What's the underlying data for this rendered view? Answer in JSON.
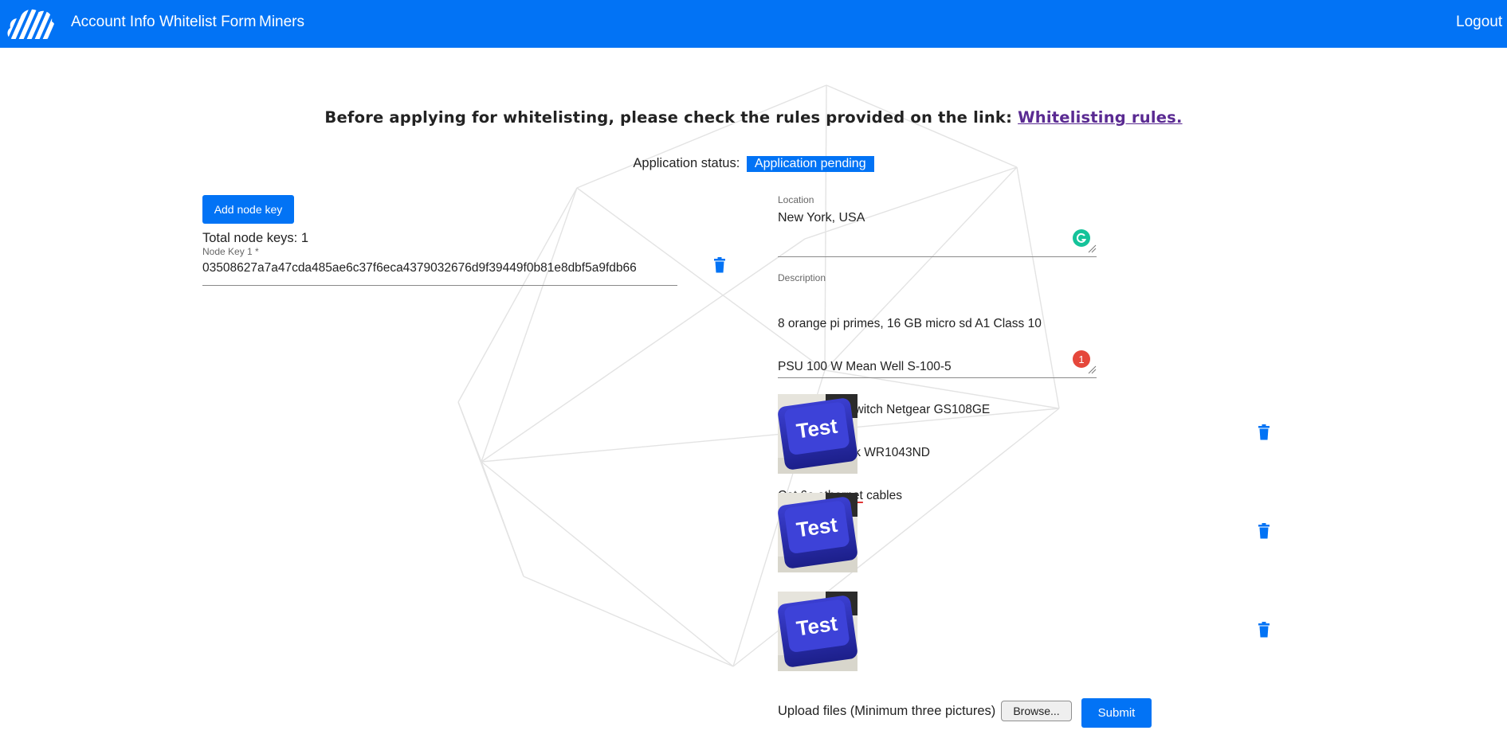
{
  "nav": {
    "logo_icon": "cloud-stripes-logo",
    "links": [
      "Account Info",
      "Whitelist Form",
      "Miners"
    ],
    "logout": "Logout"
  },
  "notice": {
    "text": "Before applying for whitelisting, please check the rules provided on the link:",
    "link_text": "Whitelisting rules."
  },
  "status": {
    "label": "Application status:",
    "value": "Application pending"
  },
  "node_keys": {
    "add_button": "Add node key",
    "total_label": "Total node keys: 1",
    "key_label": "Node Key 1 *",
    "key_value": "03508627a7a47cda485ae6c37f6eca4379032676d9f39449f0b81e8dbf5a9fdb66"
  },
  "location": {
    "label": "Location",
    "value": "New York, USA"
  },
  "description": {
    "label": "Description",
    "lines": [
      "8 orange pi primes, 16 GB micro sd A1 Class 10",
      "PSU 100 W Mean Well S-100-5",
      "Unmanaged switch Netgear GS108GE",
      "Router TP-Link WR1043ND",
      "Cat 6e ethernet cables"
    ],
    "error_count": "1"
  },
  "images": [
    {
      "caption": "Test"
    },
    {
      "caption": "Test"
    },
    {
      "caption": "Test"
    }
  ],
  "upload": {
    "label": "Upload files (Minimum three pictures)",
    "browse": "Browse...",
    "submit": "Submit"
  },
  "colors": {
    "primary": "#0273f5",
    "link_visited": "#5a2a92",
    "error": "#e5473b",
    "grammarly": "#15c39a"
  }
}
